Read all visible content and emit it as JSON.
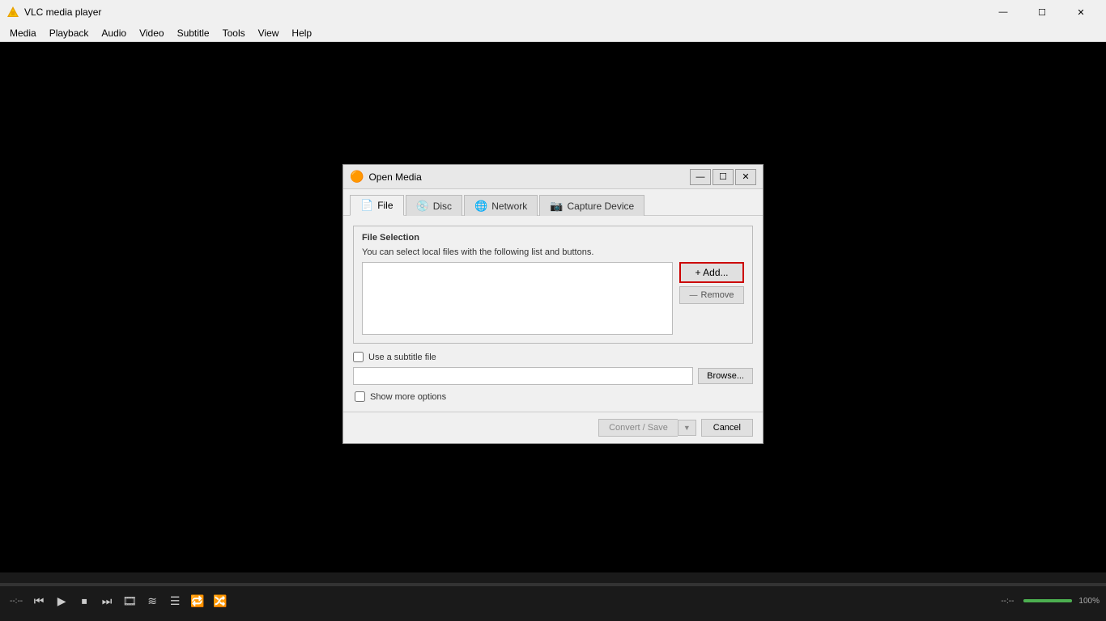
{
  "titleBar": {
    "appName": "VLC media player",
    "controls": {
      "minimize": "—",
      "maximize": "☐",
      "close": "✕"
    }
  },
  "menuBar": {
    "items": [
      "Media",
      "Playback",
      "Audio",
      "Video",
      "Subtitle",
      "Tools",
      "View",
      "Help"
    ]
  },
  "dialog": {
    "title": "Open Media",
    "controls": {
      "minimize": "—",
      "maximize": "☐",
      "close": "✕"
    },
    "tabs": [
      {
        "id": "file",
        "label": "File",
        "icon": "📄",
        "active": true
      },
      {
        "id": "disc",
        "label": "Disc",
        "icon": "💿",
        "active": false
      },
      {
        "id": "network",
        "label": "Network",
        "icon": "🌐",
        "active": false
      },
      {
        "id": "capture",
        "label": "Capture Device",
        "icon": "📷",
        "active": false
      }
    ],
    "fileSelection": {
      "groupLabel": "File Selection",
      "description": "You can select local files with the following list and buttons.",
      "addButton": "+ Add...",
      "removeButton": "Remove",
      "removeIcon": "—"
    },
    "subtitle": {
      "checkboxLabel": "Use a subtitle file",
      "browseButton": "Browse..."
    },
    "showMore": {
      "checkboxLabel": "Show more options"
    },
    "footer": {
      "convertSave": "Convert / Save",
      "convertArrow": "▼",
      "cancel": "Cancel"
    }
  },
  "bottomBar": {
    "timeLeft": "--:--",
    "timeRight": "--:--",
    "volumePercent": "100%",
    "buttons": {
      "play": "▶",
      "skipBack": "⏮",
      "stop": "⏹",
      "skipForward": "⏭",
      "frame": "🎞",
      "equalizer": "≋",
      "playlist": "☰",
      "loop": "🔁",
      "random": "🔀"
    }
  }
}
